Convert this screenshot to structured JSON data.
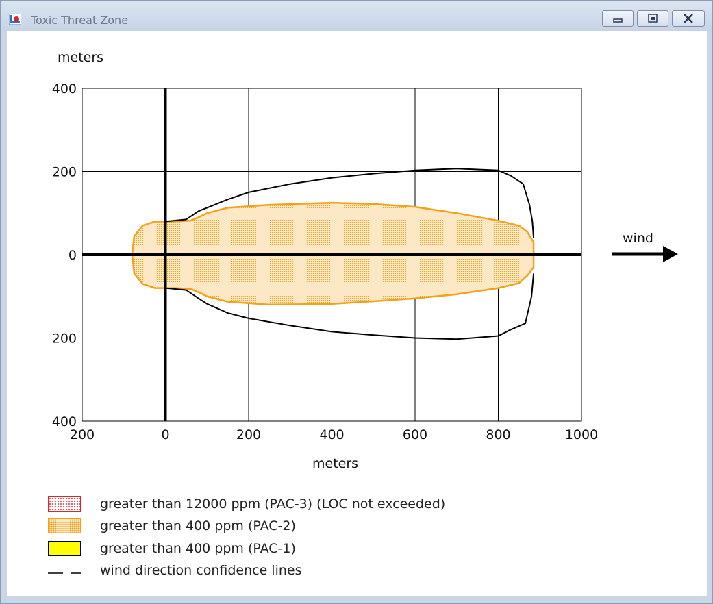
{
  "window": {
    "title": "Toxic Threat Zone"
  },
  "chart_data": {
    "type": "area",
    "title": "",
    "ylabel": "meters",
    "xlabel": "meters",
    "xlim": [
      -200,
      1000
    ],
    "ylim": [
      -400,
      400
    ],
    "x_ticks": [
      -200,
      0,
      200,
      400,
      600,
      800,
      1000
    ],
    "x_tick_labels": [
      "200",
      "0",
      "200",
      "400",
      "600",
      "800",
      "1000"
    ],
    "y_ticks": [
      400,
      200,
      0,
      -200,
      -400
    ],
    "y_tick_labels": [
      "400",
      "200",
      "0",
      "200",
      "400"
    ],
    "grid": true,
    "wind_label": "wind",
    "series": [
      {
        "name": "greater than 400 ppm (PAC-2)",
        "kind": "filled-region",
        "color": "#f5a019",
        "upper": [
          [
            -80,
            0
          ],
          [
            -75,
            45
          ],
          [
            -55,
            70
          ],
          [
            -25,
            80
          ],
          [
            20,
            80
          ],
          [
            60,
            82
          ],
          [
            80,
            90
          ],
          [
            100,
            100
          ],
          [
            150,
            113
          ],
          [
            250,
            120
          ],
          [
            400,
            125
          ],
          [
            500,
            122
          ],
          [
            600,
            115
          ],
          [
            700,
            100
          ],
          [
            800,
            82
          ],
          [
            850,
            70
          ],
          [
            870,
            55
          ],
          [
            885,
            30
          ],
          [
            885,
            0
          ]
        ],
        "lower": [
          [
            -80,
            0
          ],
          [
            -75,
            -45
          ],
          [
            -55,
            -70
          ],
          [
            -25,
            -80
          ],
          [
            20,
            -80
          ],
          [
            60,
            -82
          ],
          [
            80,
            -90
          ],
          [
            100,
            -100
          ],
          [
            150,
            -113
          ],
          [
            250,
            -120
          ],
          [
            400,
            -118
          ],
          [
            500,
            -112
          ],
          [
            600,
            -105
          ],
          [
            700,
            -95
          ],
          [
            800,
            -80
          ],
          [
            850,
            -68
          ],
          [
            870,
            -50
          ],
          [
            885,
            -30
          ],
          [
            885,
            0
          ]
        ]
      },
      {
        "name": "wind direction confidence lines",
        "kind": "outline",
        "color": "#000000",
        "upper": [
          [
            0,
            80
          ],
          [
            50,
            85
          ],
          [
            80,
            105
          ],
          [
            100,
            113
          ],
          [
            150,
            133
          ],
          [
            200,
            150
          ],
          [
            300,
            170
          ],
          [
            400,
            185
          ],
          [
            500,
            195
          ],
          [
            600,
            203
          ],
          [
            700,
            207
          ],
          [
            800,
            203
          ],
          [
            830,
            190
          ],
          [
            860,
            170
          ],
          [
            875,
            120
          ],
          [
            882,
            80
          ],
          [
            885,
            40
          ]
        ],
        "lower": [
          [
            0,
            -80
          ],
          [
            50,
            -85
          ],
          [
            80,
            -105
          ],
          [
            100,
            -118
          ],
          [
            150,
            -140
          ],
          [
            200,
            -153
          ],
          [
            300,
            -170
          ],
          [
            400,
            -185
          ],
          [
            500,
            -193
          ],
          [
            600,
            -200
          ],
          [
            700,
            -203
          ],
          [
            800,
            -195
          ],
          [
            830,
            -180
          ],
          [
            865,
            -165
          ],
          [
            880,
            -100
          ],
          [
            885,
            -45
          ]
        ]
      }
    ]
  },
  "legend": {
    "items": [
      {
        "label": "greater than 12000 ppm (PAC-3) (LOC not exceeded)",
        "swatch": "red-dotted"
      },
      {
        "label": "greater than 400 ppm (PAC-2)",
        "swatch": "orange-dotted"
      },
      {
        "label": "greater than 400 ppm (PAC-1)",
        "swatch": "yellow"
      },
      {
        "label": "wind direction confidence lines",
        "swatch": "dashed-line"
      }
    ]
  },
  "colors": {
    "pac3": "#e8202a",
    "pac2": "#f5a019",
    "pac2_fill": "#fad9a6",
    "pac1": "#ffff00",
    "confidence": "#000000"
  }
}
